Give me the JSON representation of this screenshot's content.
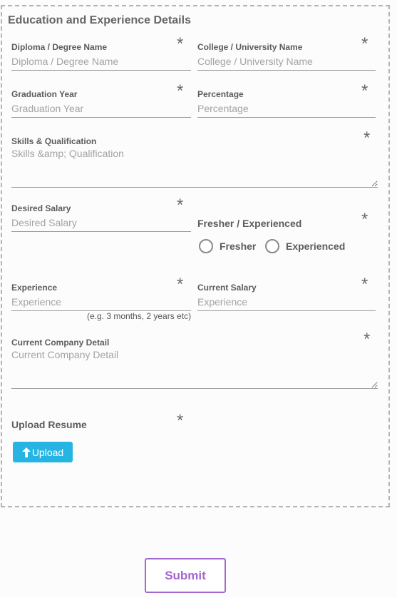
{
  "section": {
    "title": "Education and Experience Details"
  },
  "required_mark": "*",
  "fields": {
    "degree": {
      "label": "Diploma / Degree Name",
      "placeholder": "Diploma / Degree Name",
      "value": ""
    },
    "college": {
      "label": "College / University Name",
      "placeholder": "College / University Name",
      "value": ""
    },
    "grad_year": {
      "label": "Graduation Year",
      "placeholder": "Graduation Year",
      "value": ""
    },
    "percentage": {
      "label": "Percentage",
      "placeholder": "Percentage",
      "value": ""
    },
    "skills": {
      "label": "Skills & Qualification",
      "placeholder": "Skills &amp; Qualification",
      "value": ""
    },
    "desired_salary": {
      "label": "Desired Salary",
      "placeholder": "Desired Salary",
      "value": ""
    },
    "fresher": {
      "label": "Fresher / Experienced",
      "options": [
        "Fresher",
        "Experienced"
      ]
    },
    "experience": {
      "label": "Experience",
      "placeholder": "Experience",
      "value": "",
      "hint": "(e.g. 3 months, 2 years etc)"
    },
    "current_salary": {
      "label": "Current Salary",
      "placeholder": "Experience",
      "value": ""
    },
    "company": {
      "label": "Current Company Detail",
      "placeholder": "Current Company Detail",
      "value": ""
    },
    "resume": {
      "label": "Upload Resume",
      "button": "Upload"
    }
  },
  "submit": {
    "label": "Submit"
  },
  "colors": {
    "upload": "#26b5e3",
    "submit": "#a566d2"
  },
  "icons": {
    "upload": "arrow-up-icon"
  }
}
